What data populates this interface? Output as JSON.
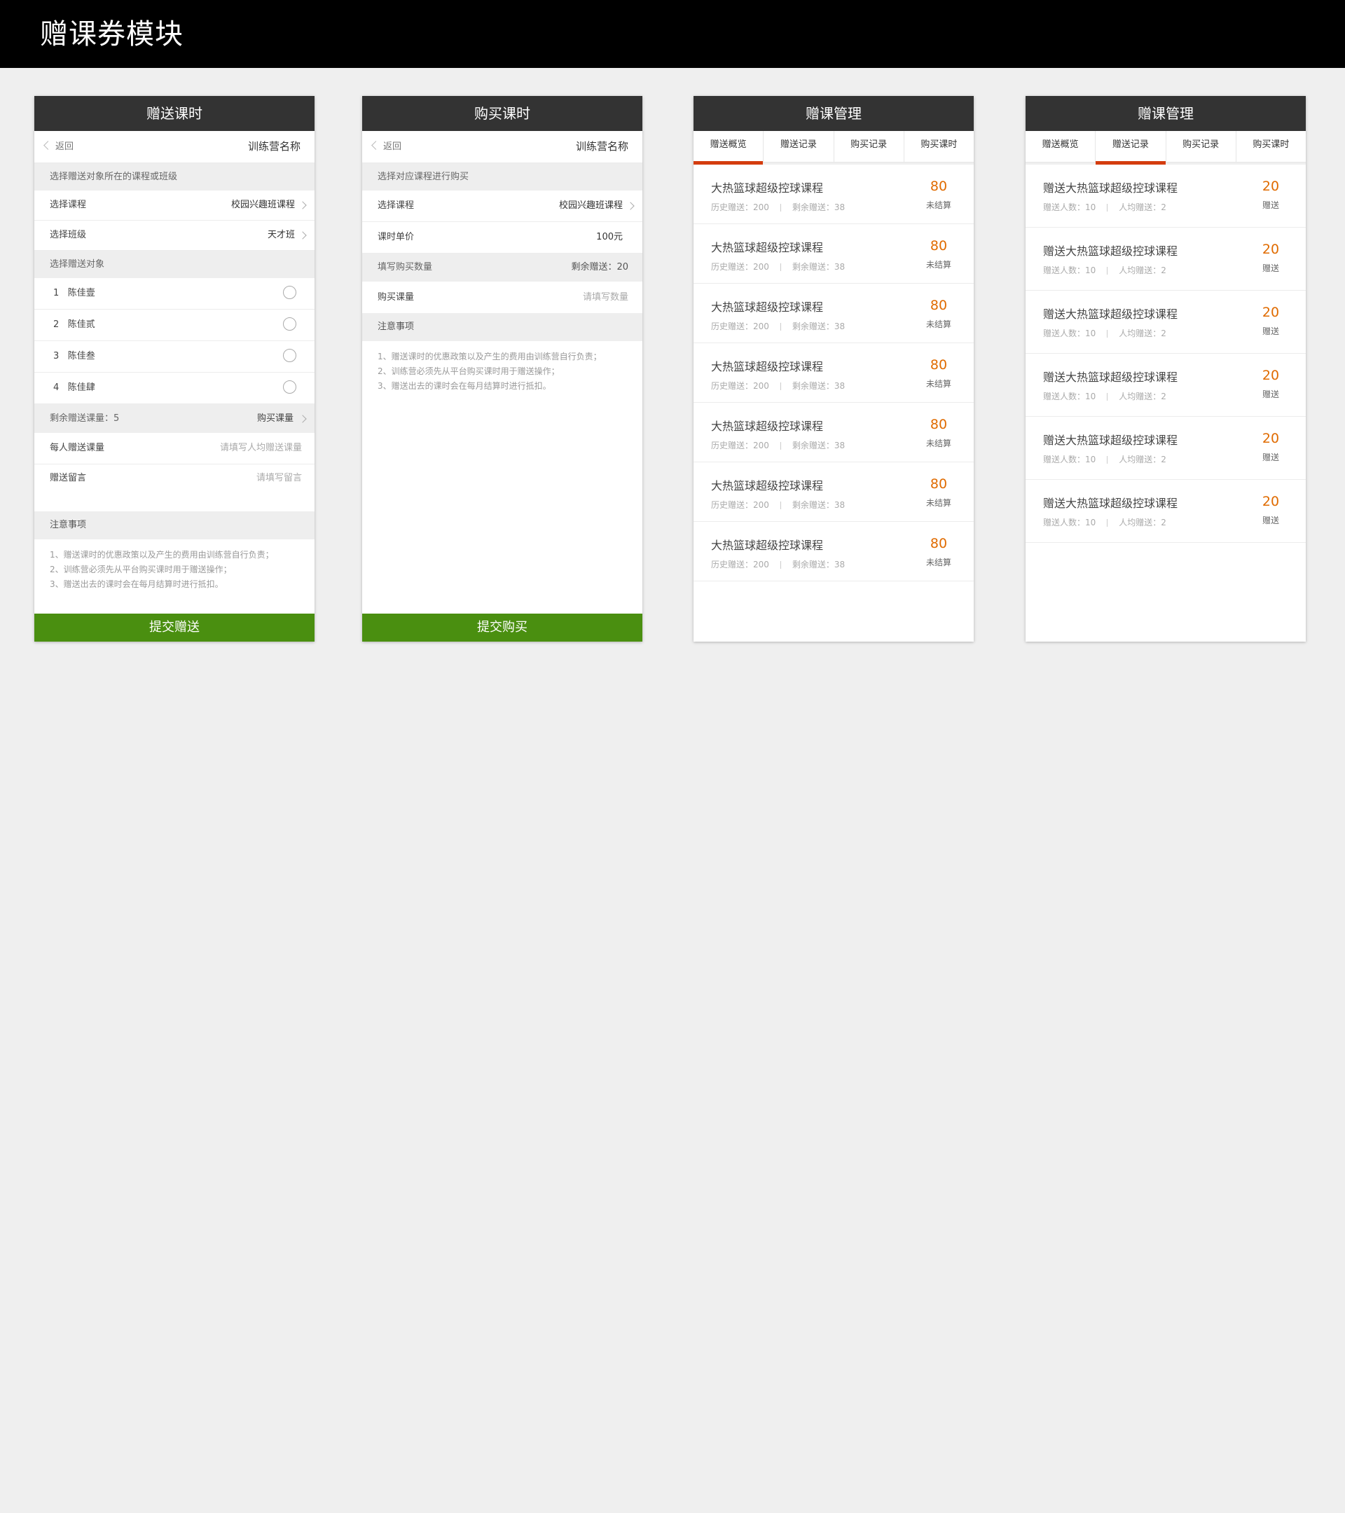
{
  "page": {
    "title": "赠课券模块"
  },
  "gift": {
    "title": "赠送课时",
    "back_label": "返回",
    "camp_name": "训练营名称",
    "section1": "选择赠送对象所在的课程或班级",
    "course_label": "选择课程",
    "course_value": "校园兴趣班课程",
    "class_label": "选择班级",
    "class_value": "天才班",
    "section2": "选择赠送对象",
    "students": [
      {
        "index": "1",
        "name": "陈佳壹"
      },
      {
        "index": "2",
        "name": "陈佳贰"
      },
      {
        "index": "3",
        "name": "陈佳叁"
      },
      {
        "index": "4",
        "name": "陈佳肆"
      }
    ],
    "remain_label": "剩余赠送课量：5",
    "buy_link": "购买课量",
    "per_label": "每人赠送课量",
    "per_placeholder": "请填写人均赠送课量",
    "msg_label": "赠送留言",
    "msg_placeholder": "请填写留言",
    "notes_title": "注意事项",
    "notes": [
      "1、赠送课时的优惠政策以及产生的费用由训练营自行负责；",
      "2、训练营必须先从平台购买课时用于赠送操作；",
      "3、赠送出去的课时会在每月结算时进行抵扣。"
    ],
    "submit": "提交赠送"
  },
  "buy": {
    "title": "购买课时",
    "back_label": "返回",
    "camp_name": "训练营名称",
    "section1": "选择对应课程进行购买",
    "course_label": "选择课程",
    "course_value": "校园兴趣班课程",
    "price_label": "课时单价",
    "price_value": "100元",
    "qty_section": "填写购买数量",
    "qty_remain": "剩余赠送：20",
    "amount_label": "购买课量",
    "amount_placeholder": "请填写数量",
    "notes_title": "注意事项",
    "notes": [
      "1、赠送课时的优惠政策以及产生的费用由训练营自行负责；",
      "2、训练营必须先从平台购买课时用于赠送操作；",
      "3、赠送出去的课时会在每月结算时进行抵扣。"
    ],
    "submit": "提交购买"
  },
  "manage1": {
    "title": "赠课管理",
    "tabs": [
      "赠送概览",
      "赠送记录",
      "购买记录",
      "购买课时"
    ],
    "active_tab": 0,
    "items": [
      {
        "title": "大热篮球超级控球课程",
        "sub1": "历史赠送：200",
        "sub2": "剩余赠送：38",
        "num": "80",
        "num_label": "未结算"
      },
      {
        "title": "大热篮球超级控球课程",
        "sub1": "历史赠送：200",
        "sub2": "剩余赠送：38",
        "num": "80",
        "num_label": "未结算"
      },
      {
        "title": "大热篮球超级控球课程",
        "sub1": "历史赠送：200",
        "sub2": "剩余赠送：38",
        "num": "80",
        "num_label": "未结算"
      },
      {
        "title": "大热篮球超级控球课程",
        "sub1": "历史赠送：200",
        "sub2": "剩余赠送：38",
        "num": "80",
        "num_label": "未结算"
      },
      {
        "title": "大热篮球超级控球课程",
        "sub1": "历史赠送：200",
        "sub2": "剩余赠送：38",
        "num": "80",
        "num_label": "未结算"
      },
      {
        "title": "大热篮球超级控球课程",
        "sub1": "历史赠送：200",
        "sub2": "剩余赠送：38",
        "num": "80",
        "num_label": "未结算"
      },
      {
        "title": "大热篮球超级控球课程",
        "sub1": "历史赠送：200",
        "sub2": "剩余赠送：38",
        "num": "80",
        "num_label": "未结算"
      }
    ]
  },
  "manage2": {
    "title": "赠课管理",
    "tabs": [
      "赠送概览",
      "赠送记录",
      "购买记录",
      "购买课时"
    ],
    "active_tab": 1,
    "items": [
      {
        "title": "赠送大热篮球超级控球课程",
        "sub1": "赠送人数：10",
        "sub2": "人均赠送：2",
        "num": "20",
        "num_label": "赠送"
      },
      {
        "title": "赠送大热篮球超级控球课程",
        "sub1": "赠送人数：10",
        "sub2": "人均赠送：2",
        "num": "20",
        "num_label": "赠送"
      },
      {
        "title": "赠送大热篮球超级控球课程",
        "sub1": "赠送人数：10",
        "sub2": "人均赠送：2",
        "num": "20",
        "num_label": "赠送"
      },
      {
        "title": "赠送大热篮球超级控球课程",
        "sub1": "赠送人数：10",
        "sub2": "人均赠送：2",
        "num": "20",
        "num_label": "赠送"
      },
      {
        "title": "赠送大热篮球超级控球课程",
        "sub1": "赠送人数：10",
        "sub2": "人均赠送：2",
        "num": "20",
        "num_label": "赠送"
      },
      {
        "title": "赠送大热篮球超级控球课程",
        "sub1": "赠送人数：10",
        "sub2": "人均赠送：2",
        "num": "20",
        "num_label": "赠送"
      }
    ]
  }
}
